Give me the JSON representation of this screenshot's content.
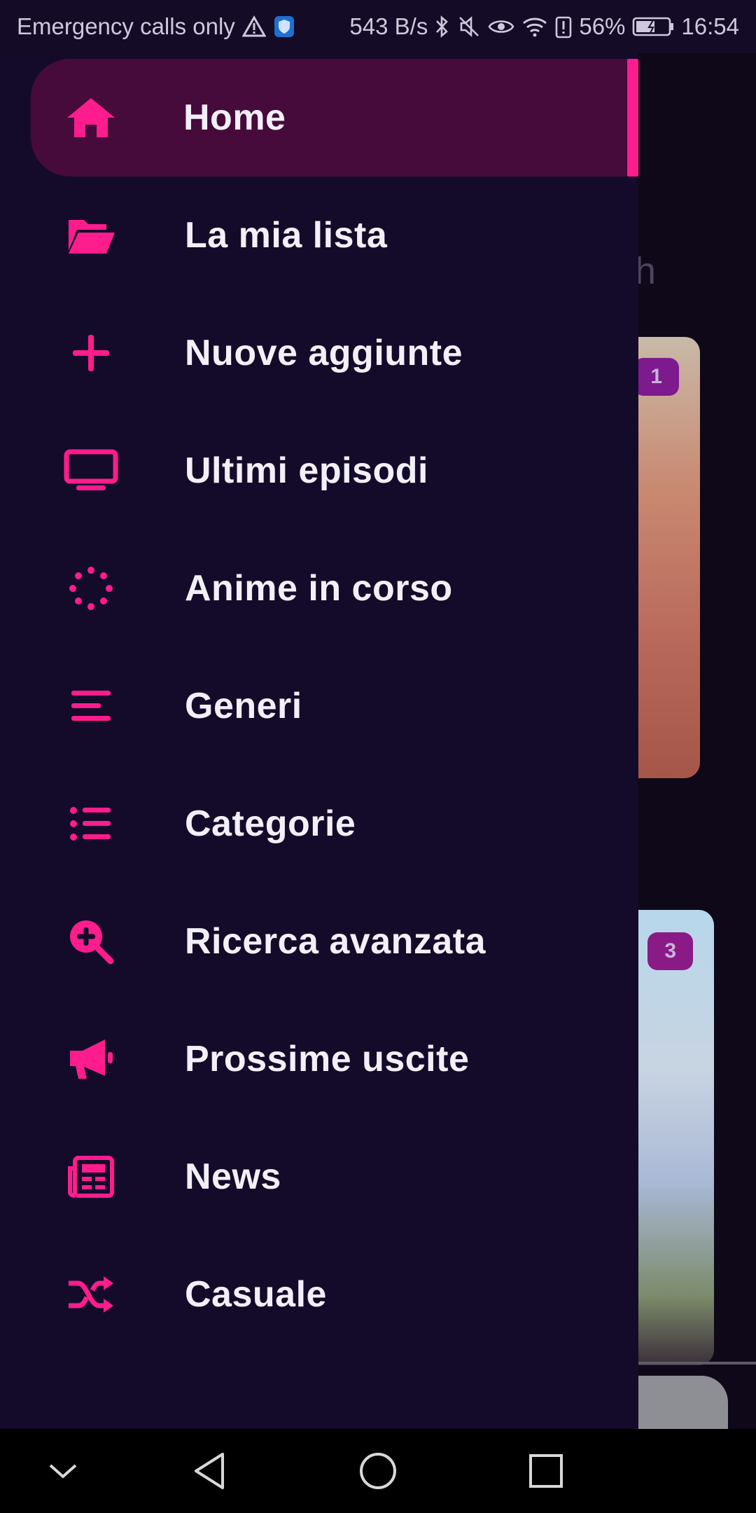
{
  "status_bar": {
    "carrier_text": "Emergency calls only",
    "speed": "543 B/s",
    "battery_percent": "56%",
    "time": "16:54",
    "icons": [
      "warning-icon",
      "vpn-shield-icon",
      "bluetooth-icon",
      "mute-icon",
      "eye-comfort-icon",
      "wifi-icon",
      "battery-saver-icon",
      "battery-icon"
    ]
  },
  "colors": {
    "accent": "#ff1c8c",
    "drawer_bg": "#140b2a",
    "active_bg": "#460a3b",
    "text": "#f3eff8"
  },
  "background": {
    "heading_fragment": "nth",
    "card_badges": [
      "1",
      "3"
    ]
  },
  "drawer": {
    "items": [
      {
        "label": "Home",
        "icon": "home-icon",
        "active": true
      },
      {
        "label": "La mia lista",
        "icon": "folder-open-icon",
        "active": false
      },
      {
        "label": "Nuove aggiunte",
        "icon": "plus-icon",
        "active": false
      },
      {
        "label": "Ultimi episodi",
        "icon": "monitor-icon",
        "active": false
      },
      {
        "label": "Anime in corso",
        "icon": "spinner-icon",
        "active": false
      },
      {
        "label": "Generi",
        "icon": "lines-icon",
        "active": false
      },
      {
        "label": "Categorie",
        "icon": "list-icon",
        "active": false
      },
      {
        "label": "Ricerca avanzata",
        "icon": "search-plus-icon",
        "active": false
      },
      {
        "label": "Prossime uscite",
        "icon": "megaphone-icon",
        "active": false
      },
      {
        "label": "News",
        "icon": "newspaper-icon",
        "active": false
      },
      {
        "label": "Casuale",
        "icon": "shuffle-icon",
        "active": false
      }
    ]
  },
  "nav_bar": {
    "buttons": [
      "chevron-down-icon",
      "back-icon",
      "home-circle-icon",
      "recents-icon"
    ]
  }
}
